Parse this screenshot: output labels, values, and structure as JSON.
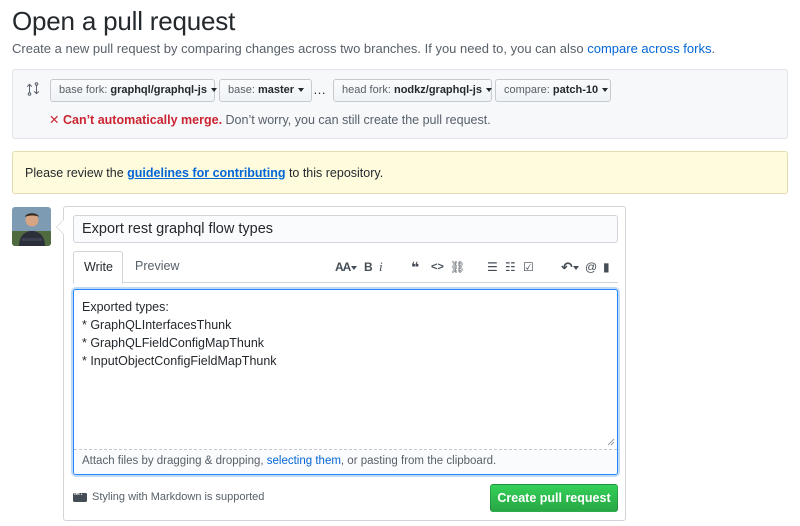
{
  "header": {
    "title": "Open a pull request",
    "subtitle_prefix": "Create a new pull request by comparing changes across two branches. If you need to, you can also ",
    "subtitle_link": "compare across forks",
    "subtitle_suffix": "."
  },
  "range": {
    "base_fork_label": "base fork:",
    "base_fork_value": "graphql/graphql-js",
    "base_label": "base:",
    "base_value": "master",
    "ellipsis": "…",
    "head_fork_label": "head fork:",
    "head_fork_value": "nodkz/graphql-js",
    "compare_label": "compare:",
    "compare_value": "patch-10",
    "merge_status_icon": "✕",
    "merge_status_bad": "Can’t automatically merge.",
    "merge_status_text": " Don’t worry, you can still create the pull request."
  },
  "flash": {
    "prefix": "Please review the ",
    "link": "guidelines for contributing",
    "suffix": " to this repository."
  },
  "form": {
    "title_value": "Export rest graphql flow types",
    "tabs": {
      "write": "Write",
      "preview": "Preview"
    },
    "toolbar": {
      "header": "AA",
      "bold": "B",
      "italic": "i",
      "quote": "❝",
      "code": "<>",
      "link": "⛓",
      "ul": "☰",
      "ol": "☷",
      "tasks": "☑",
      "reply": "↶",
      "mention": "@",
      "bookmark": "▮"
    },
    "body": "Exported types:\n* GraphQLInterfacesThunk\n* GraphQLFieldConfigMapThunk\n* InputObjectConfigFieldMapThunk",
    "attach_prefix": "Attach files by dragging & dropping, ",
    "attach_link": "selecting them",
    "attach_suffix": ", or pasting from the clipboard.",
    "markdown_note": "Styling with Markdown is supported",
    "submit_label": "Create pull request"
  },
  "colors": {
    "link": "#0366d6",
    "error": "#cb2431",
    "primary_button": "#28a745",
    "flash_bg": "#fffbdd"
  }
}
